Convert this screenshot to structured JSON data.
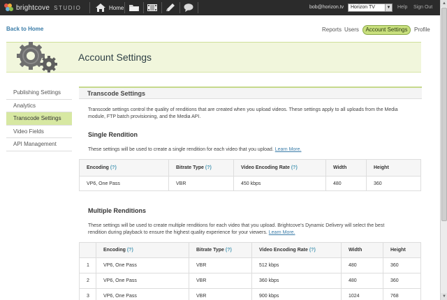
{
  "topbar": {
    "brand": "brightcove",
    "product": "STUDIO",
    "home_label": "Home",
    "icons": [
      "home-icon",
      "folder-icon",
      "media-icon",
      "publishing-icon",
      "chat-icon"
    ],
    "user_email": "bob@horizon.tv",
    "account": "Horizon TV",
    "help_label": "Help",
    "signout_label": "Sign Out"
  },
  "header": {
    "back_label": "Back to Home",
    "nav": {
      "reports": "Reports",
      "users": "Users",
      "account_settings": "Account Settings",
      "profile": "Profile"
    },
    "page_title": "Account Settings"
  },
  "sidebar": {
    "items": [
      {
        "label": "Publishing Settings",
        "active": false
      },
      {
        "label": "Analytics",
        "active": false
      },
      {
        "label": "Transcode Settings",
        "active": true
      },
      {
        "label": "Video Fields",
        "active": false
      },
      {
        "label": "API Management",
        "active": false
      }
    ]
  },
  "main": {
    "section_title": "Transcode Settings",
    "intro": "Transcode settings control the quality of renditions that are created when you upload videos. These settings apply to all uploads from the Media module, FTP batch provisioning, and the Media API.",
    "single": {
      "title": "Single Rendition",
      "desc": "These settings will be used to create a single rendition for each video that you upload.",
      "learn_more": "Learn More.",
      "headers": {
        "encoding": "Encoding",
        "bitrate": "Bitrate Type",
        "rate": "Video Encoding Rate",
        "width": "Width",
        "height": "Height"
      },
      "help_mark": "(?)",
      "row": {
        "encoding": "VP6, One Pass",
        "bitrate": "VBR",
        "rate": "450 kbps",
        "width": "480",
        "height": "360"
      }
    },
    "multiple": {
      "title": "Multiple Renditions",
      "desc": "These settings will be used to create multiple renditions for each video that you upload. Brightcove's Dynamic Delivery will select the best rendition during playback to ensure the highest quality experience for your viewers.",
      "learn_more": "Learn More.",
      "headers": {
        "encoding": "Encoding",
        "bitrate": "Bitrate Type",
        "rate": "Video Encoding Rate",
        "width": "Width",
        "height": "Height"
      },
      "help_mark": "(?)",
      "rows": [
        {
          "num": "1",
          "encoding": "VP6, One Pass",
          "bitrate": "VBR",
          "rate": "512 kbps",
          "width": "480",
          "height": "360"
        },
        {
          "num": "2",
          "encoding": "VP6, One Pass",
          "bitrate": "VBR",
          "rate": "360 kbps",
          "width": "480",
          "height": "360"
        },
        {
          "num": "3",
          "encoding": "VP6, One Pass",
          "bitrate": "VBR",
          "rate": "900 kbps",
          "width": "1024",
          "height": "768"
        }
      ]
    }
  },
  "colors": {
    "topbar": "#2b2b2b",
    "accent_green": "#c8df7d",
    "title_band": "#f1f6dc",
    "link_blue": "#3a7ca8"
  }
}
